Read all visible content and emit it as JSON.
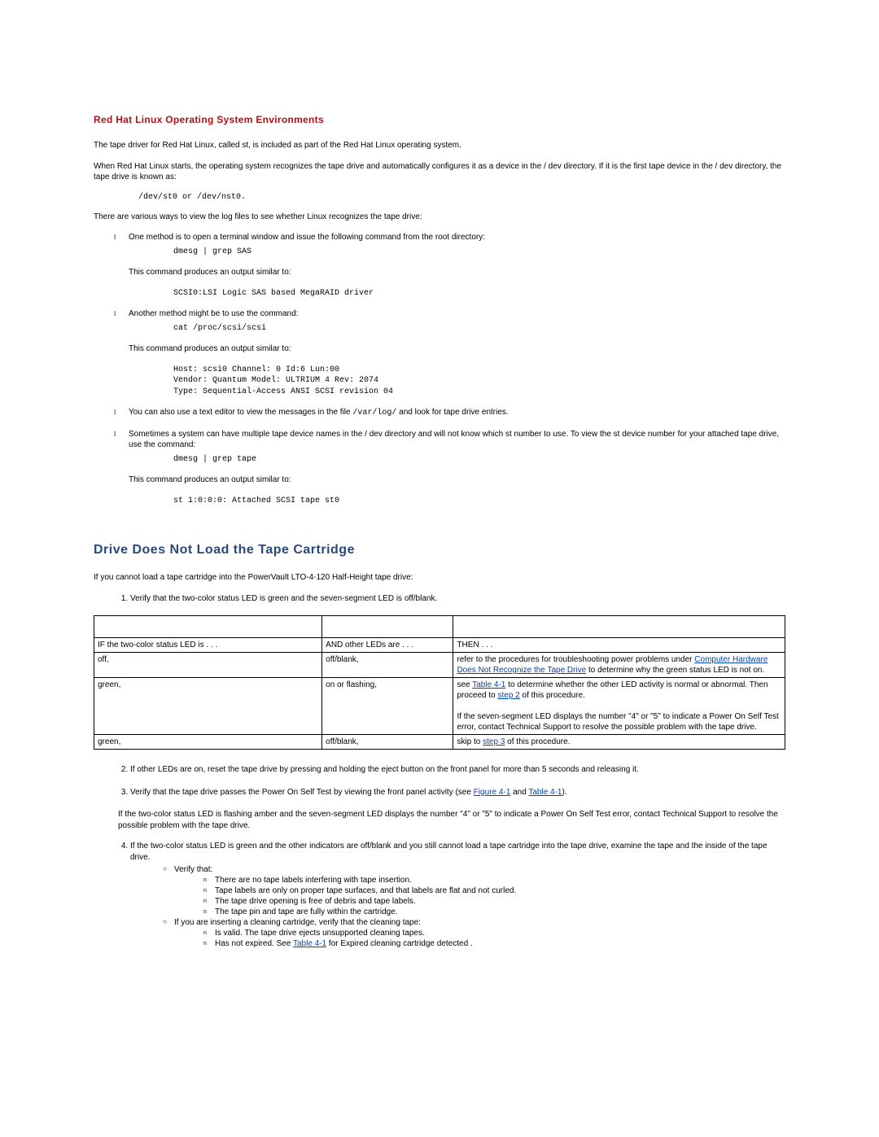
{
  "s1": {
    "title": "Red Hat Linux Operating System Environments",
    "p1": "The tape driver for Red Hat Linux, called st, is included as part of the Red Hat Linux operating system.",
    "p2": "When Red Hat Linux starts, the operating system recognizes the tape drive and automatically configures it as a device in the / dev directory. If it is the first tape device in the / dev directory, the tape drive is known as:",
    "code1": "/dev/st0 or /dev/nst0.",
    "p3": "There are various ways to view the log files to see whether Linux recognizes the tape drive:",
    "li1": "One method is to open a terminal window and issue the following command from the root directory:",
    "code2": "dmesg | grep SAS",
    "p4": "This command produces an output similar to:",
    "code3": "SCSI0:LSI Logic SAS based MegaRAID driver",
    "li2": "Another method might be to use the command:",
    "code4": "cat /proc/scsi/scsi",
    "p5": "This command produces an output similar to:",
    "code5": "Host: scsi0 Channel: 0 Id:6 Lun:00\nVendor: Quantum Model: ULTRIUM 4 Rev: 2074\nType: Sequential-Access ANSI SCSI revision 04",
    "li3a": "You can also use a text editor to view the messages in the file ",
    "li3code": "/var/log/",
    "li3b": " and look for tape drive entries.",
    "li4": "Sometimes a system can have multiple tape device names in the / dev directory and will not know which st number to use. To view the st device number for your attached tape drive, use the command:",
    "code6": "dmesg | grep tape",
    "p6": "This command produces an output similar to:",
    "code7": "st 1:0:0:0: Attached SCSI tape st0"
  },
  "s2": {
    "title": "Drive Does Not Load the Tape Cartridge",
    "p1": "If you cannot load a tape cartridge into the PowerVault LTO-4-120 Half-Height tape drive:",
    "step1": "Verify that the two-color status LED is green and the seven-segment LED is off/blank.",
    "tbl": {
      "h1": "IF the two-color status LED is . . .",
      "h2": "AND other LEDs are . . .",
      "h3": "THEN . . .",
      "r1c1": "off,",
      "r1c2": "off/blank,",
      "r1c3a": "refer to the procedures for troubleshooting power problems under ",
      "r1link": "Computer Hardware Does Not Recognize the Tape Drive",
      "r1c3b": " to determine why the green status LED is not on.",
      "r2c1": "green,",
      "r2c2": "on or flashing,",
      "r2c3a": "see ",
      "r2link1": "Table 4-1",
      "r2c3b": " to determine whether the other LED activity is normal or abnormal. Then proceed to ",
      "r2link2": "step 2",
      "r2c3c": " of this procedure.",
      "r2c3d": "If the seven-segment LED displays the number \"4\" or \"5\" to indicate a Power On Self Test error, contact Technical Support to resolve the possible problem with the tape drive.",
      "r3c1": "green,",
      "r3c2": "off/blank,",
      "r3c3a": "skip to ",
      "r3link": "step 3",
      "r3c3b": " of this procedure."
    },
    "step2": "If other LEDs are on, reset the tape drive by pressing and holding the eject button on the front panel for more than 5 seconds and releasing it.",
    "step3a": "Verify that the tape drive passes the Power On Self Test by viewing the front panel activity (see ",
    "step3link1": "Figure 4-1",
    "step3mid": " and ",
    "step3link2": "Table 4-1",
    "step3b": ").",
    "step3p": "If the two-color status LED is flashing amber and the seven-segment LED displays the number \"4\" or \"5\" to indicate a Power On Self Test error, contact Technical Support to resolve the possible problem with the tape drive.",
    "step4": "If the two-color status LED is green and the other indicators are off/blank and you still cannot load a tape cartridge into the tape drive, examine the tape and the inside of the tape drive.",
    "s4verify": "Verify that:",
    "s4v1": "There are no tape labels interfering with tape insertion.",
    "s4v2": "Tape labels are only on proper tape surfaces, and that labels are flat and not curled.",
    "s4v3": "The tape drive opening is free of debris and tape labels.",
    "s4v4": "The tape pin and tape are fully within the cartridge.",
    "s4clean": "If you are inserting a cleaning cartridge, verify that the cleaning tape:",
    "s4c1": "Is valid. The tape drive ejects unsupported cleaning tapes.",
    "s4c2a": "Has not expired. See ",
    "s4c2link": "Table 4-1",
    "s4c2b": " for Expired cleaning cartridge detected ."
  }
}
